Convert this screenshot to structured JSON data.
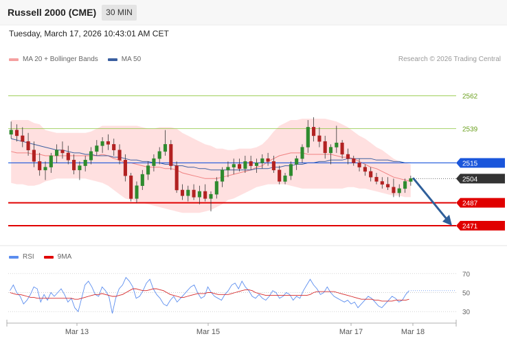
{
  "header": {
    "title": "Russell 2000 (CME)",
    "interval": "30 MIN",
    "timestamp": "Tuesday, March 17, 2026 10:43:01 AM CET"
  },
  "legend": {
    "ma20": "MA 20 + Bollinger Bands",
    "ma50": "MA 50",
    "copyright": "Research © 2026 Trading Central",
    "rsi": "RSI",
    "rsi_ma": "9MA"
  },
  "colors": {
    "candle_up": "#2e8b2e",
    "candle_down": "#b22222",
    "bollinger_fill": "#ffd6d6",
    "ma20": "#f08080",
    "ma50": "#3a5fa0",
    "pivot_blue": "#1a56db",
    "support_red": "#e00000",
    "resistance_green": "#8dc63f",
    "arrow": "#2f5f9a",
    "rsi_line": "#5b8def",
    "rsi_ma_line": "#d62728"
  },
  "chart_data": {
    "type": "candlestick",
    "y_range": [
      2458,
      2583
    ],
    "levels": [
      {
        "label": "2562",
        "value": 2562,
        "kind": "resistance"
      },
      {
        "label": "2539",
        "value": 2539,
        "kind": "resistance"
      },
      {
        "label": "2515",
        "value": 2515,
        "kind": "pivot"
      },
      {
        "label": "2504",
        "value": 2504,
        "kind": "last"
      },
      {
        "label": "2487",
        "value": 2487,
        "kind": "support"
      },
      {
        "label": "2471",
        "value": 2471,
        "kind": "support"
      }
    ],
    "x_ticks": [
      "Mar 13",
      "Mar 15",
      "Mar 17",
      "Mar 18"
    ],
    "forecast_arrow": {
      "from": 2504,
      "to": 2471
    },
    "ohlc": [
      [
        2535,
        2544,
        2532,
        2538
      ],
      [
        2538,
        2542,
        2530,
        2534
      ],
      [
        2534,
        2540,
        2526,
        2530
      ],
      [
        2530,
        2536,
        2520,
        2524
      ],
      [
        2524,
        2530,
        2512,
        2516
      ],
      [
        2516,
        2522,
        2506,
        2510
      ],
      [
        2510,
        2516,
        2503,
        2512
      ],
      [
        2512,
        2522,
        2508,
        2520
      ],
      [
        2520,
        2528,
        2515,
        2524
      ],
      [
        2524,
        2530,
        2518,
        2522
      ],
      [
        2522,
        2527,
        2514,
        2517
      ],
      [
        2517,
        2521,
        2507,
        2510
      ],
      [
        2510,
        2516,
        2503,
        2513
      ],
      [
        2513,
        2520,
        2509,
        2517
      ],
      [
        2517,
        2526,
        2514,
        2523
      ],
      [
        2523,
        2531,
        2520,
        2527
      ],
      [
        2527,
        2533,
        2522,
        2530
      ],
      [
        2530,
        2535,
        2524,
        2528
      ],
      [
        2528,
        2532,
        2520,
        2524
      ],
      [
        2524,
        2528,
        2514,
        2517
      ],
      [
        2517,
        2521,
        2502,
        2506
      ],
      [
        2506,
        2508,
        2488,
        2490
      ],
      [
        2490,
        2502,
        2487,
        2499
      ],
      [
        2499,
        2510,
        2496,
        2507
      ],
      [
        2507,
        2516,
        2503,
        2513
      ],
      [
        2513,
        2521,
        2509,
        2518
      ],
      [
        2518,
        2526,
        2514,
        2523
      ],
      [
        2523,
        2538,
        2520,
        2528
      ],
      [
        2528,
        2531,
        2510,
        2513
      ],
      [
        2513,
        2516,
        2494,
        2496
      ],
      [
        2496,
        2500,
        2489,
        2492
      ],
      [
        2492,
        2499,
        2488,
        2496
      ],
      [
        2496,
        2500,
        2489,
        2491
      ],
      [
        2491,
        2499,
        2486,
        2495
      ],
      [
        2495,
        2500,
        2488,
        2490
      ],
      [
        2490,
        2495,
        2481,
        2493
      ],
      [
        2493,
        2505,
        2490,
        2502
      ],
      [
        2502,
        2512,
        2498,
        2510
      ],
      [
        2510,
        2516,
        2505,
        2512
      ],
      [
        2512,
        2518,
        2507,
        2514
      ],
      [
        2514,
        2518,
        2509,
        2511
      ],
      [
        2511,
        2520,
        2508,
        2516
      ],
      [
        2516,
        2520,
        2510,
        2513
      ],
      [
        2513,
        2518,
        2508,
        2515
      ],
      [
        2515,
        2521,
        2511,
        2518
      ],
      [
        2518,
        2522,
        2513,
        2516
      ],
      [
        2516,
        2520,
        2508,
        2510
      ],
      [
        2510,
        2513,
        2500,
        2502
      ],
      [
        2502,
        2508,
        2500,
        2506
      ],
      [
        2506,
        2516,
        2503,
        2514
      ],
      [
        2514,
        2520,
        2510,
        2518
      ],
      [
        2518,
        2528,
        2515,
        2526
      ],
      [
        2526,
        2545,
        2522,
        2540
      ],
      [
        2540,
        2547,
        2530,
        2534
      ],
      [
        2534,
        2540,
        2526,
        2530
      ],
      [
        2530,
        2534,
        2518,
        2522
      ],
      [
        2522,
        2528,
        2514,
        2526
      ],
      [
        2526,
        2541,
        2522,
        2529
      ],
      [
        2529,
        2531,
        2518,
        2521
      ],
      [
        2521,
        2525,
        2514,
        2518
      ],
      [
        2518,
        2520,
        2513,
        2515
      ],
      [
        2515,
        2518,
        2509,
        2512
      ],
      [
        2512,
        2514,
        2506,
        2509
      ],
      [
        2509,
        2512,
        2502,
        2505
      ],
      [
        2505,
        2508,
        2500,
        2502
      ],
      [
        2502,
        2505,
        2497,
        2500
      ],
      [
        2500,
        2505,
        2496,
        2498
      ],
      [
        2498,
        2504,
        2491,
        2494
      ],
      [
        2494,
        2500,
        2491,
        2497
      ],
      [
        2497,
        2504,
        2494,
        2502
      ],
      [
        2502,
        2506,
        2499,
        2504
      ]
    ],
    "bollinger_upper": [
      2545,
      2545,
      2545,
      2545,
      2543,
      2542,
      2538,
      2537,
      2536,
      2536,
      2536,
      2536,
      2536,
      2536,
      2537,
      2539,
      2541,
      2541,
      2541,
      2541,
      2541,
      2541,
      2541,
      2540,
      2539,
      2539,
      2540,
      2540,
      2540,
      2539,
      2536,
      2534,
      2532,
      2530,
      2528,
      2527,
      2525,
      2525,
      2524,
      2524,
      2525,
      2525,
      2525,
      2526,
      2528,
      2532,
      2537,
      2541,
      2543,
      2545,
      2545,
      2546,
      2546,
      2546,
      2546,
      2546,
      2545,
      2544,
      2542,
      2540,
      2537,
      2534,
      2532,
      2529,
      2526,
      2524,
      2521,
      2518,
      2516,
      2515,
      2514
    ],
    "bollinger_lower": [
      2501,
      2500,
      2500,
      2499,
      2499,
      2500,
      2502,
      2503,
      2504,
      2504,
      2504,
      2504,
      2504,
      2504,
      2503,
      2502,
      2501,
      2499,
      2496,
      2493,
      2490,
      2489,
      2488,
      2487,
      2486,
      2485,
      2484,
      2483,
      2482,
      2481,
      2480,
      2480,
      2480,
      2480,
      2481,
      2482,
      2484,
      2486,
      2489,
      2490,
      2492,
      2494,
      2496,
      2498,
      2499,
      2500,
      2500,
      2500,
      2500,
      2499,
      2498,
      2497,
      2497,
      2497,
      2497,
      2497,
      2497,
      2497,
      2497,
      2498,
      2498,
      2497,
      2497,
      2496,
      2495,
      2494,
      2493,
      2492,
      2492,
      2491,
      2491
    ],
    "ma20": [
      2523,
      2522,
      2522,
      2522,
      2521,
      2521,
      2520,
      2520,
      2520,
      2520,
      2520,
      2520,
      2520,
      2520,
      2520,
      2520,
      2521,
      2520,
      2518,
      2517,
      2515,
      2515,
      2514,
      2513,
      2512,
      2512,
      2512,
      2511,
      2511,
      2510,
      2508,
      2507,
      2506,
      2505,
      2504,
      2504,
      2504,
      2505,
      2506,
      2507,
      2508,
      2509,
      2510,
      2512,
      2513,
      2516,
      2518,
      2520,
      2521,
      2522,
      2522,
      2522,
      2521,
      2521,
      2521,
      2521,
      2521,
      2520,
      2519,
      2519,
      2518,
      2516,
      2514,
      2512,
      2511,
      2509,
      2507,
      2505,
      2504,
      2503,
      2502
    ],
    "ma50": [
      2532,
      2531,
      2530,
      2529,
      2528,
      2527,
      2526,
      2525,
      2524,
      2524,
      2523,
      2522,
      2522,
      2521,
      2521,
      2520,
      2520,
      2520,
      2519,
      2519,
      2518,
      2517,
      2517,
      2516,
      2516,
      2515,
      2515,
      2514,
      2514,
      2513,
      2513,
      2512,
      2512,
      2511,
      2511,
      2510,
      2510,
      2510,
      2510,
      2510,
      2510,
      2510,
      2510,
      2511,
      2511,
      2511,
      2512,
      2512,
      2513,
      2513,
      2514,
      2514,
      2515,
      2515,
      2516,
      2516,
      2517,
      2517,
      2517,
      2518,
      2518,
      2518,
      2518,
      2518,
      2517,
      2517,
      2517,
      2516,
      2516,
      2515,
      2515
    ],
    "rsi": {
      "ticks": [
        70,
        50,
        30
      ],
      "range": [
        20,
        80
      ],
      "rsi_values": [
        52,
        58,
        50,
        46,
        38,
        42,
        48,
        56,
        54,
        40,
        48,
        42,
        50,
        46,
        50,
        54,
        48,
        40,
        44,
        34,
        30,
        44,
        58,
        62,
        56,
        48,
        46,
        56,
        52,
        46,
        28,
        44,
        54,
        58,
        66,
        62,
        56,
        44,
        46,
        52,
        60,
        64,
        54,
        48,
        44,
        38,
        36,
        42,
        46,
        40,
        44,
        48,
        52,
        56,
        58,
        50,
        44,
        46,
        56,
        50,
        46,
        44,
        42,
        48,
        52,
        58,
        60,
        54,
        62,
        56,
        52,
        46,
        44,
        48,
        44,
        42,
        46,
        52,
        50,
        44,
        46,
        50,
        48,
        42,
        46,
        44,
        52,
        58,
        64,
        58,
        54,
        48,
        50,
        56,
        50,
        46,
        44,
        42,
        40,
        42,
        38,
        40,
        34,
        38,
        42,
        46,
        44,
        40,
        36,
        34,
        38,
        42,
        46,
        44,
        40,
        42,
        48,
        52
      ],
      "ma_values": [
        50,
        49,
        48,
        48,
        47,
        46,
        45,
        45,
        44,
        44,
        44,
        44,
        44,
        44,
        44,
        44,
        44,
        44,
        44,
        43,
        43,
        44,
        45,
        46,
        47,
        48,
        48,
        49,
        48,
        47,
        46,
        46,
        47,
        48,
        50,
        52,
        54,
        54,
        53,
        52,
        52,
        53,
        54,
        54,
        53,
        52,
        50,
        48,
        47,
        46,
        45,
        45,
        46,
        47,
        48,
        49,
        49,
        49,
        50,
        50,
        49,
        48,
        48,
        48,
        48,
        49,
        50,
        51,
        52,
        53,
        53,
        52,
        50,
        49,
        48,
        47,
        47,
        47,
        47,
        47,
        47,
        47,
        47,
        47,
        47,
        47,
        47,
        47,
        48,
        50,
        51,
        51,
        51,
        51,
        51,
        51,
        50,
        49,
        48,
        47,
        46,
        45,
        44,
        43,
        43,
        43,
        43,
        42,
        42,
        41,
        41,
        41,
        41,
        42,
        42,
        42,
        42,
        43
      ]
    }
  }
}
